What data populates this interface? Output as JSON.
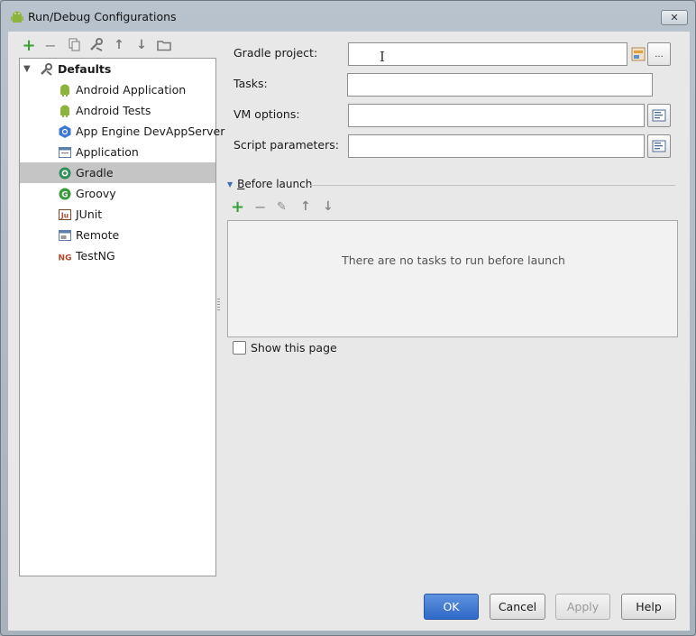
{
  "window": {
    "title": "Run/Debug Configurations",
    "close_glyph": "✕"
  },
  "left_toolbar": {
    "icons": [
      "add-icon",
      "remove-icon",
      "copy-icon",
      "edit-defaults-icon",
      "move-up-icon",
      "move-down-icon",
      "folder-icon"
    ],
    "glyphs": [
      "+",
      "−",
      "❐",
      "✎",
      "🡑",
      "🡓",
      "▭"
    ]
  },
  "tree": {
    "root": {
      "label": "Defaults",
      "expand_glyph": "▼"
    },
    "items": [
      {
        "label": "Android Application",
        "icon": "android-icon",
        "color": "#8cb43c"
      },
      {
        "label": "Android Tests",
        "icon": "android-icon",
        "color": "#8cb43c"
      },
      {
        "label": "App Engine DevAppServer",
        "icon": "app-engine-icon",
        "color": "#3d78d6"
      },
      {
        "label": "Application",
        "icon": "application-icon",
        "color": "#5b7fa8"
      },
      {
        "label": "Gradle",
        "icon": "gradle-icon",
        "color": "#2c8f55",
        "selected": true
      },
      {
        "label": "Groovy",
        "icon": "groovy-icon",
        "color": "#3a9a3a"
      },
      {
        "label": "JUnit",
        "icon": "junit-icon",
        "color": "#7a4a2a"
      },
      {
        "label": "Remote",
        "icon": "remote-icon",
        "color": "#5b7fa8"
      },
      {
        "label": "TestNG",
        "icon": "testng-icon",
        "color": "#b5462a"
      }
    ]
  },
  "form": {
    "gradle_project_label": "Gradle project:",
    "gradle_project_value": "",
    "browse_glyph": "...",
    "tasks_label": "Tasks:",
    "tasks_value": "",
    "vm_options_label": "VM options:",
    "vm_options_value": "",
    "script_params_label": "Script parameters:",
    "script_params_value": ""
  },
  "before_launch": {
    "title_prefix": "B",
    "title_rest": "efore launch",
    "collapse_glyph": "▼",
    "empty_text": "There are no tasks to run before launch",
    "toolbar_glyphs": [
      "+",
      "−",
      "✎",
      "🡑",
      "🡓"
    ]
  },
  "show_this_page": {
    "label": "Show this page",
    "checked": false
  },
  "buttons": {
    "ok": "OK",
    "cancel": "Cancel",
    "apply": "Apply",
    "help": "Help"
  },
  "colors": {
    "primary": "#2f69c7",
    "add_green": "#3a9e3a",
    "selection": "#c5c5c5"
  }
}
